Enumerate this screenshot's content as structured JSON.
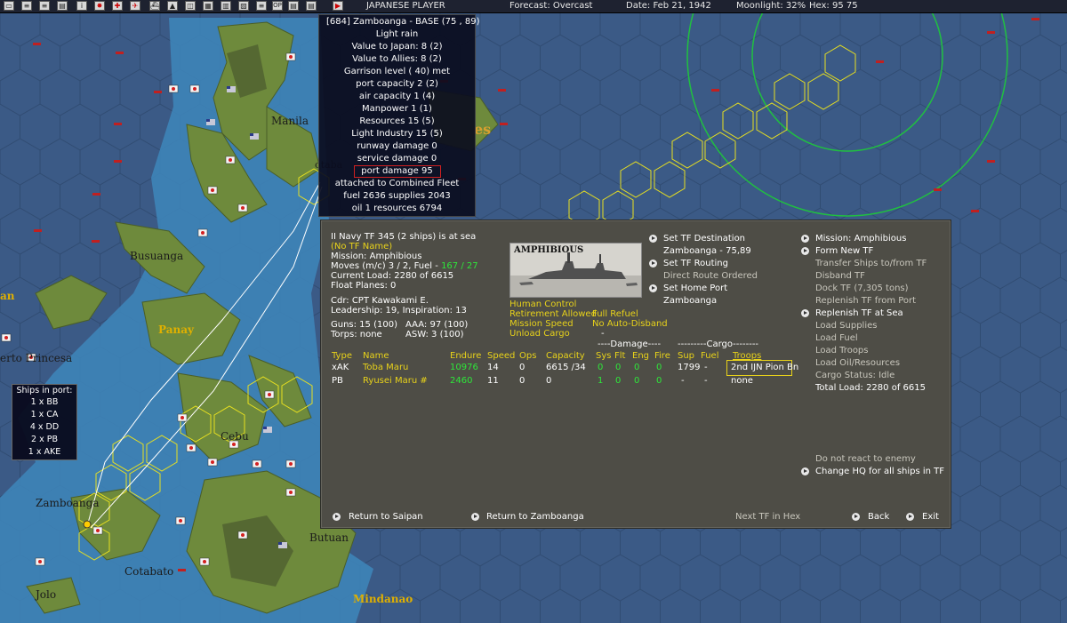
{
  "topbar": {
    "player": "JAPANESE PLAYER",
    "forecast": "Forecast: Overcast",
    "date": "Date: Feb 21, 1942",
    "moonlight": "Moonlight: 32%",
    "hex": "Hex: 95 75",
    "icons": [
      "save-icon",
      "list-icon",
      "list-icon",
      "info-icon",
      "sun-icon",
      "medical-icon",
      "plane-icon",
      "ship-icon",
      "ground-icon",
      "map-icon",
      "stack-icon",
      "op-icon",
      "hq-icon",
      "report-icon",
      "end-turn-icon"
    ]
  },
  "map_labels": {
    "busuanga": "Busuanga",
    "manila": "Manila",
    "panay": "Panay",
    "puerto_princesa": "erto Princesa",
    "cebu": "Cebu",
    "zamboanga": "Zamboanga",
    "butuan": "Butuan",
    "cotabato": "Cotabato",
    "jolo": "Jolo",
    "mindanao": "Mindanao",
    "es_fragment": "es",
    "an_fragment": "an",
    "cotaba_fragment": "otaba"
  },
  "base_info": {
    "title": "[684] Zamboanga  - BASE  (75 , 89)",
    "lines": [
      "Light rain",
      "Value to Japan: 8 (2)",
      "Value to Allies: 8 (2)",
      "Garrison level ( 40) met",
      "port capacity 2 (2)",
      "air capacity 1 (4)",
      "Manpower  1 (1)",
      "Resources  15 (5)",
      "Light Industry  15 (5)",
      "runway damage 0",
      "service damage 0",
      "port damage 95",
      "attached to Combined Fleet",
      "fuel 2636  supplies 2043",
      "oil 1  resources 6794"
    ]
  },
  "ships_in_port": {
    "title": "Ships in port:",
    "items": [
      "1 x BB",
      "1 x CA",
      "4 x DD",
      "2 x PB",
      "1 x AKE"
    ]
  },
  "tf_panel": {
    "header": "II Navy TF 345 (2 ships) is at sea",
    "tf_name": "(No TF Name)",
    "mission": "Mission: Amphibious",
    "moves": "Moves (m/c)  3 / 2, Fuel -",
    "fuel_value": "167 / 27",
    "current_load": "Current Load:  2280 of 6615",
    "float_planes": "Float Planes:  0",
    "cdr": "Cdr: CPT  Kawakami E.",
    "leadership": "Leadership: 19, Inspiration: 13",
    "guns": "Guns: 15 (100)",
    "aaa": "AAA: 97 (100)",
    "torps": "Torps: none",
    "asw": "ASW: 3 (100)",
    "photo_label": "AMPHIBIOUS",
    "human_control": "Human Control",
    "retirement": "Retirement Allowed",
    "full_refuel": "Full Refuel",
    "mission_speed": "Mission Speed",
    "no_auto_disband": "No Auto-Disband",
    "unload_cargo": "Unload Cargo",
    "dash": "-",
    "middle_actions": {
      "set_dest": "Set TF Destination",
      "dest_value": "Zamboanga - 75,89",
      "set_routing": "Set TF Routing",
      "routing_value": "Direct Route Ordered",
      "set_home": "Set Home Port",
      "home_value": "Zamboanga"
    },
    "right_actions": {
      "mission": "Mission: Amphibious",
      "form_new": "Form New TF",
      "transfer": "Transfer Ships to/from TF",
      "disband": "Disband TF",
      "dock": "Dock TF (7,305 tons)",
      "replenish_port": "Replenish TF from Port",
      "replenish_sea": "Replenish TF at Sea",
      "load_supplies": "Load Supplies",
      "load_fuel": "Load Fuel",
      "load_troops": "Load Troops",
      "load_oil": "Load Oil/Resources",
      "cargo_status": "Cargo Status: Idle",
      "total_load": "Total Load: 2280 of 6615",
      "no_react": "Do not react to enemy",
      "change_hq": "Change HQ for all ships in TF"
    },
    "table": {
      "damage_header": "----Damage----",
      "cargo_header": "---------Cargo--------",
      "columns": [
        "Type",
        "Name",
        "Endure",
        "Speed",
        "Ops",
        "Capacity",
        "Sys",
        "Flt",
        "Eng",
        "Fire",
        "Sup",
        "Fuel",
        "Troops"
      ],
      "rows": [
        {
          "type": "xAK",
          "name": "Toba Maru",
          "endure": "10976",
          "speed": "14",
          "ops": "0",
          "capacity": "6615 /34",
          "sys": "0",
          "flt": "0",
          "eng": "0",
          "fire": "0",
          "sup": "1799",
          "fuel": "-",
          "troops": "2nd IJN Pion Bn"
        },
        {
          "type": "PB",
          "name": "Ryusei Maru #",
          "endure": "2460",
          "speed": "11",
          "ops": "0",
          "capacity": "0",
          "sys": "1",
          "flt": "0",
          "eng": "0",
          "fire": "0",
          "sup": "-",
          "fuel": "-",
          "troops": "none"
        }
      ]
    },
    "bottom": {
      "return_saipan": "Return to Saipan",
      "return_zamboanga": "Return to Zamboanga",
      "next_tf": "Next TF in Hex",
      "back": "Back",
      "exit": "Exit"
    }
  },
  "colors": {
    "ocean": "#3b5a86",
    "land": "#6e8a3c",
    "hex_yellow": "#e8e020",
    "range_green": "#20c040",
    "panel": "#4e4d46",
    "highlight_yellow": "#e8d21a",
    "highlight_green": "#2ee63a"
  }
}
